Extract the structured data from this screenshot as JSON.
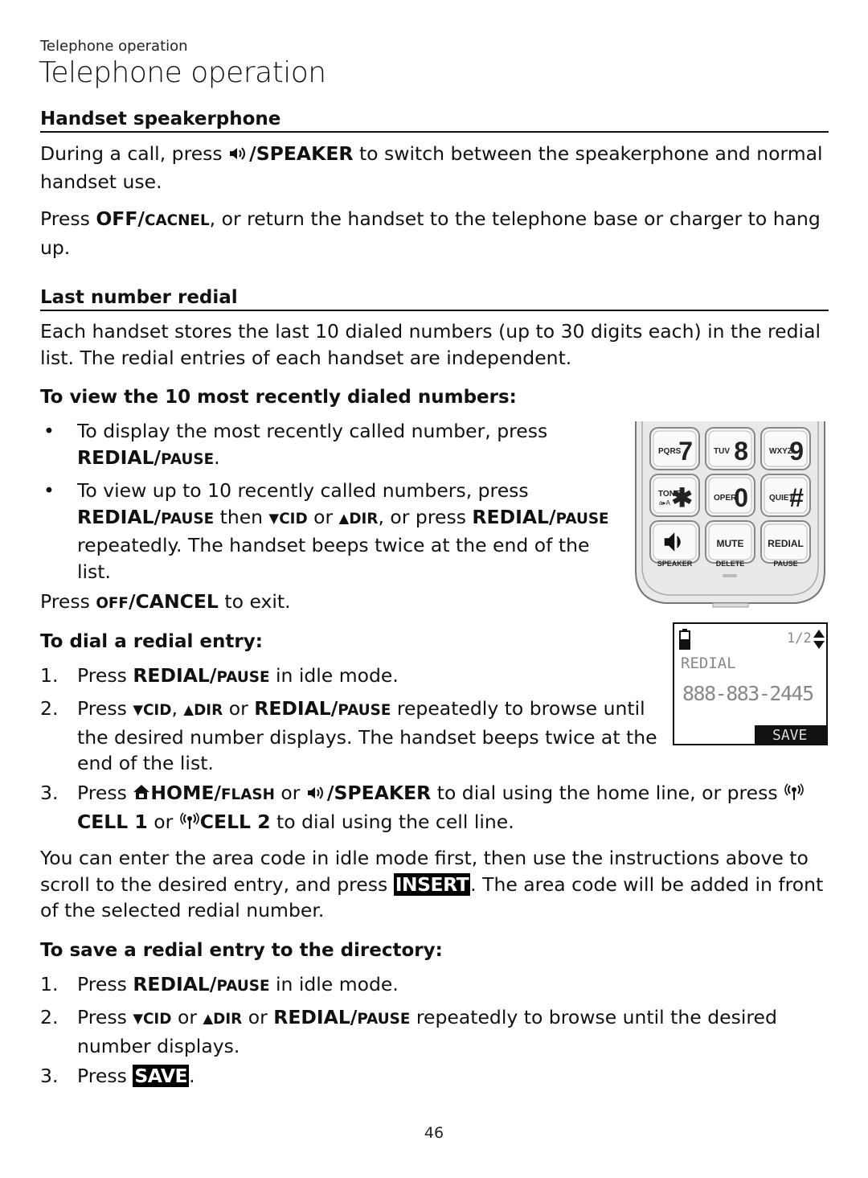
{
  "running_head": "Telephone operation",
  "page_title": "Telephone operation",
  "sections": {
    "speakerphone": {
      "heading": "Handset speakerphone",
      "p1": {
        "pre": "During a call, press ",
        "key": "/SPEAKER",
        "post": " to switch between the speakerphone and normal handset use."
      },
      "p2": {
        "pre": "Press ",
        "key_main": "OFF/",
        "key_sc": "CACNEL",
        "post": ", or return the handset to the telephone base or charger to hang up."
      }
    },
    "redial": {
      "heading": "Last number redial",
      "intro": "Each handset stores the last 10 dialed numbers (up to 30 digits each) in the redial list. The redial entries of each handset are independent.",
      "view": {
        "heading": "To view the 10 most recently dialed numbers:",
        "bullet": "•",
        "b1": {
          "pre": "To display the most recently called number, press ",
          "key": "REDIAL/",
          "key_sc": "PAUSE",
          "post": "."
        },
        "b2": {
          "pre": "To view up to 10 recently called numbers, press ",
          "key": "REDIAL/",
          "key_sc": "PAUSE",
          "mid1": " then ",
          "down": "▼",
          "cid": "CID",
          "or1": " or ",
          "up": "▲",
          "dir": "DIR",
          "mid2": ", or press ",
          "key2": "REDIAL/",
          "key2_sc": "PAUSE",
          "post": " repeatedly. The handset beeps twice at the end of the list."
        },
        "exit": {
          "pre": "Press ",
          "key_sc": "OFF",
          "key": "/CANCEL",
          "post": " to exit."
        }
      },
      "dial": {
        "heading": "To dial a redial entry:",
        "s1": {
          "num": "1.",
          "pre": "Press ",
          "key": "REDIAL/",
          "key_sc": "PAUSE",
          "post": " in idle mode."
        },
        "s2": {
          "num": "2.",
          "pre": "Press ",
          "down": "▼",
          "cid": "CID",
          "comma": ", ",
          "up": "▲",
          "dir": "DIR",
          "or1": " or ",
          "key": "REDIAL/",
          "key_sc": "PAUSE",
          "post": " repeatedly to browse until the desired number displays. The handset beeps twice at the end of the list."
        },
        "s3": {
          "num": "3.",
          "pre": "Press ",
          "home": "HOME/",
          "home_sc": "FLASH",
          "or1": " or ",
          "speaker": "/SPEAKER",
          "mid": " to dial using the home line, or press ",
          "cell1": "CELL 1",
          "or2": " or ",
          "cell2": "CELL 2",
          "post": " to dial using the cell line."
        },
        "note": {
          "pre": "You can enter the area code in idle mode first, then use the instructions above to scroll to the desired entry, and press ",
          "key": "INSERT",
          "post": ". The area code will be added in front of the selected redial number."
        }
      },
      "save": {
        "heading": "To save a redial entry to the directory:",
        "s1": {
          "num": "1.",
          "pre": "Press ",
          "key": "REDIAL/",
          "key_sc": "PAUSE",
          "post": " in idle mode."
        },
        "s2": {
          "num": "2.",
          "pre": "Press ",
          "down": "▼",
          "cid": "CID",
          "or1": " or ",
          "up": "▲",
          "dir": "DIR",
          "or2": " or ",
          "key": "REDIAL/",
          "key_sc": "PAUSE",
          "post": " repeatedly to browse until the desired number displays."
        },
        "s3": {
          "num": "3.",
          "pre": "Press ",
          "key": "SAVE",
          "post": "."
        }
      }
    }
  },
  "keypad": {
    "keys": [
      {
        "letters": "PQRS",
        "digit": "7"
      },
      {
        "letters": "TUV",
        "digit": "8"
      },
      {
        "letters": "WXYZ",
        "digit": "9"
      },
      {
        "letters": "TONE",
        "sub": "a▸A",
        "digit": "✱"
      },
      {
        "letters": "OPER",
        "digit": "0"
      },
      {
        "letters": "QUIET",
        "digit": "#"
      },
      {
        "letters": "",
        "digit": ""
      },
      {
        "letters": "MUTE",
        "digit": ""
      },
      {
        "letters": "REDIAL",
        "digit": ""
      }
    ],
    "labels": [
      "SPEAKER",
      "DELETE",
      "PAUSE"
    ]
  },
  "lcd": {
    "counter": "1/2",
    "title": "REDIAL",
    "number": "888-883-2445",
    "softkey": "SAVE"
  },
  "page_number": "46"
}
